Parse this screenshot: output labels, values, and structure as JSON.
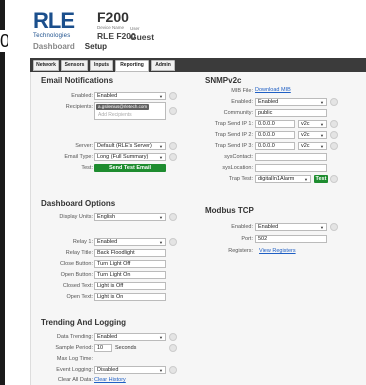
{
  "edge": {
    "glyph": "0"
  },
  "header": {
    "logo_main": "RLE",
    "logo_sub": "Technologies",
    "device_name": "F200",
    "device_label": "Device Name",
    "device_model": "RLE F200",
    "user_label": "User",
    "user_name": "Guest"
  },
  "topnav": {
    "dashboard": "Dashboard",
    "setup": "Setup"
  },
  "tabs": [
    "Network",
    "Sensors",
    "Inputs",
    "Reporting",
    "Admin"
  ],
  "email": {
    "title": "Email Notifications",
    "enabled_label": "Enabled:",
    "enabled_value": "Enabled",
    "recipients_label": "Recipients:",
    "recipient_chip": "a.gsilenius@rletech.com",
    "recipient_placeholder": "Add Recipients",
    "server_label": "Server:",
    "server_value": "Default (RLE's Server)",
    "email_type_label": "Email Type:",
    "email_type_value": "Long (Full Summary)",
    "test_label": "Test:",
    "test_button": "Send Test Email"
  },
  "dashboard": {
    "title": "Dashboard Options",
    "display_units_label": "Display Units:",
    "display_units_value": "English",
    "relay1_label": "Relay 1:",
    "relay1_value": "Enabled",
    "relay_title_label": "Relay Title:",
    "relay_title_value": "Back Floodlight",
    "close_button_label": "Close Button:",
    "close_button_value": "Turn Light Off",
    "open_button_label": "Open Button:",
    "open_button_value": "Turn Light On",
    "closed_text_label": "Closed Text:",
    "closed_text_value": "Light is Off",
    "open_text_label": "Open Text:",
    "open_text_value": "Light is On"
  },
  "trending": {
    "title": "Trending And Logging",
    "data_trending_label": "Data Trending:",
    "data_trending_value": "Enabled",
    "sample_period_label": "Sample Period:",
    "sample_period_value": "10",
    "sample_period_unit": "Seconds",
    "max_log_label": "Max Log Time:",
    "event_logging_label": "Event Logging:",
    "event_logging_value": "Disabled",
    "clear_all_label": "Clear All Data:",
    "clear_history_link": "Clear History"
  },
  "snmp": {
    "title": "SNMPv2c",
    "mib_label": "MIB File:",
    "mib_link": "Download MIB",
    "enabled_label": "Enabled:",
    "enabled_value": "Enabled",
    "community_label": "Community:",
    "community_value": "public",
    "trap1_label": "Trap Send IP 1:",
    "trap1_value": "0.0.0.0",
    "trap1_ver": "v2c",
    "trap2_label": "Trap Send IP 2:",
    "trap2_value": "0.0.0.0",
    "trap2_ver": "v2c",
    "trap3_label": "Trap Send IP 3:",
    "trap3_value": "0.0.0.0",
    "trap3_ver": "v2c",
    "syscontact_label": "sysContact:",
    "syslocation_label": "sysLocation:",
    "traptest_label": "Trap Test:",
    "traptest_value": "digitalIn1Alarm",
    "traptest_button": "Test"
  },
  "modbus": {
    "title": "Modbus TCP",
    "enabled_label": "Enabled:",
    "enabled_value": "Enabled",
    "port_label": "Port:",
    "port_value": "502",
    "registers_label": "Registers:",
    "registers_link": "View Registers"
  },
  "colors": {
    "brand": "#1b4f8c",
    "tabbar": "#3b3b3b",
    "green": "#1e8c2f",
    "link": "#1f5fc4"
  },
  "icons": [
    "help-icon",
    "dropdown-arrow-icon"
  ]
}
